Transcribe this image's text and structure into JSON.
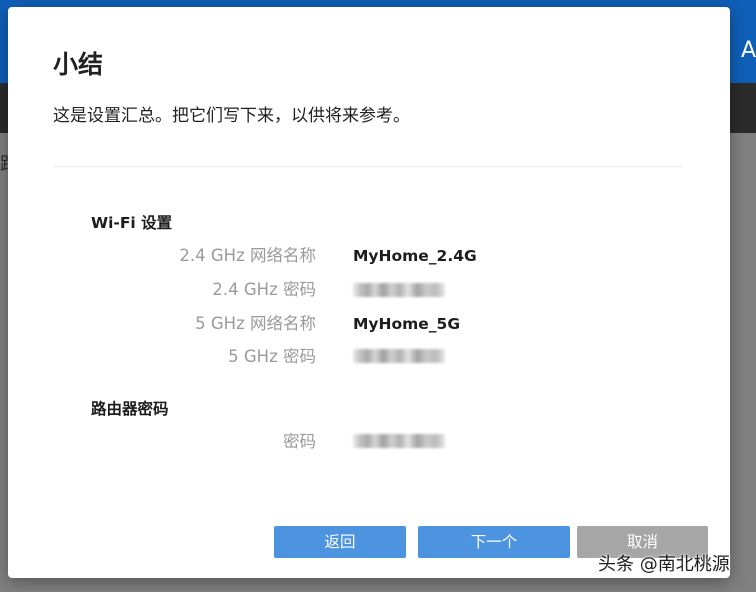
{
  "background": {
    "header_text": "A",
    "side_text": "跟"
  },
  "dialog": {
    "title": "小结",
    "description": "这是设置汇总。把它们写下来，以供将来参考。",
    "wifi_section": {
      "title": "Wi-Fi 设置",
      "rows": [
        {
          "label": "2.4 GHz 网络名称",
          "value": "MyHome_2.4G"
        },
        {
          "label": "2.4 GHz 密码",
          "value": ""
        },
        {
          "label": "5 GHz 网络名称",
          "value": "MyHome_5G"
        },
        {
          "label": "5 GHz 密码",
          "value": ""
        }
      ]
    },
    "router_section": {
      "title": "路由器密码",
      "rows": [
        {
          "label": "密码",
          "value": ""
        }
      ]
    },
    "buttons": {
      "back": "返回",
      "next": "下一个",
      "cancel": "取消"
    }
  },
  "watermark": "头条 @南北桃源",
  "colors": {
    "header_blue": "#0f5fb8",
    "primary_button": "#4d94e0",
    "cancel_button": "#a6a6a6",
    "label_gray": "#9a9a9a"
  }
}
